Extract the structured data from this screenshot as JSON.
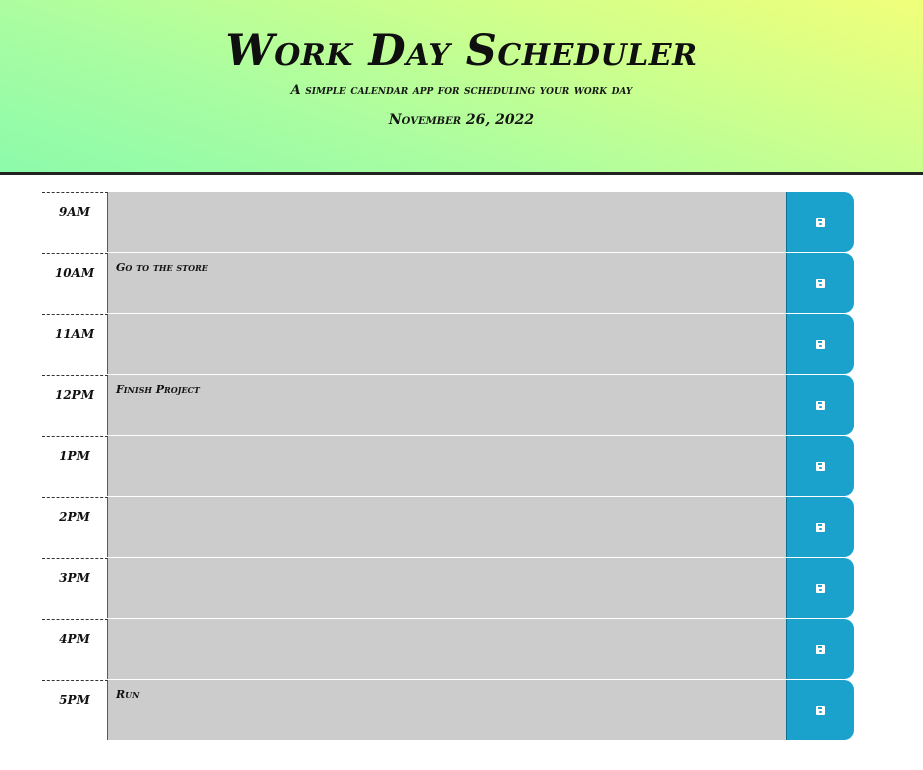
{
  "header": {
    "title": "Work Day Scheduler",
    "lead": "A simple calendar app for scheduling your work day",
    "current_day": "November 26, 2022"
  },
  "colors": {
    "gradient_start": "#8cfbab",
    "gradient_end": "#f1ff7a",
    "past_block": "#cccccc",
    "save_button": "#1aa2cc"
  },
  "time_blocks": [
    {
      "hour": "9AM",
      "text": ""
    },
    {
      "hour": "10AM",
      "text": "Go to the store"
    },
    {
      "hour": "11AM",
      "text": ""
    },
    {
      "hour": "12PM",
      "text": "Finish Project"
    },
    {
      "hour": "1PM",
      "text": ""
    },
    {
      "hour": "2PM",
      "text": ""
    },
    {
      "hour": "3PM",
      "text": ""
    },
    {
      "hour": "4PM",
      "text": ""
    },
    {
      "hour": "5PM",
      "text": "Run"
    }
  ],
  "save_icon": "floppy-disk-icon"
}
